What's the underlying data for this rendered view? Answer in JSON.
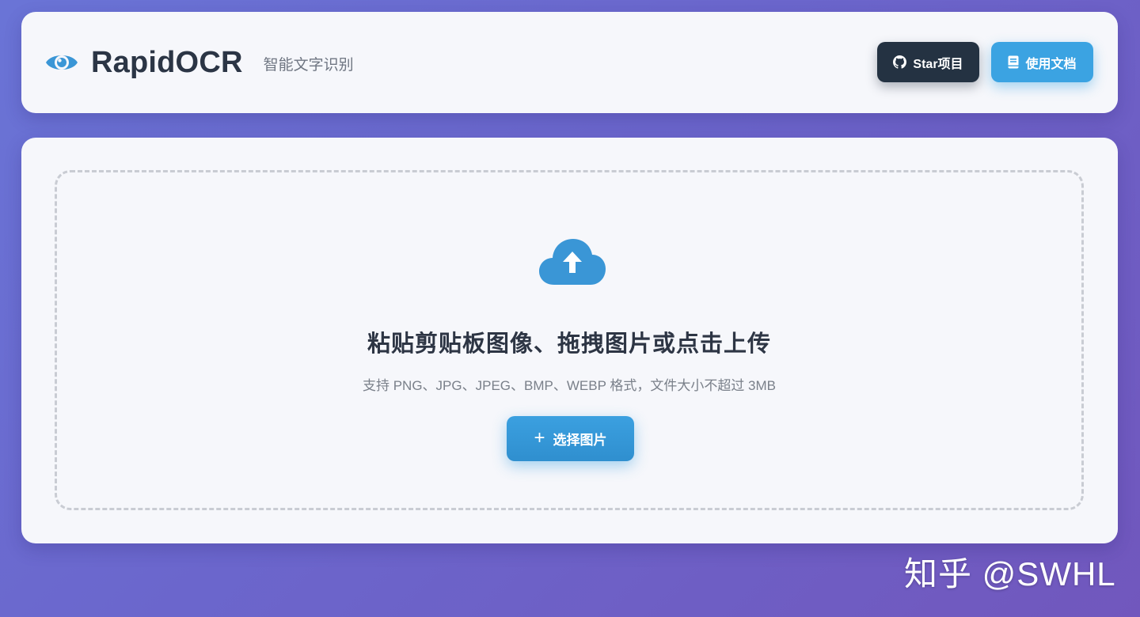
{
  "header": {
    "brand_name": "RapidOCR",
    "brand_subtitle": "智能文字识别",
    "logo_icon": "eye-icon",
    "star_button": {
      "label": "Star项目",
      "icon": "github-icon"
    },
    "docs_button": {
      "label": "使用文档",
      "icon": "book-icon"
    }
  },
  "upload": {
    "icon": "cloud-upload-icon",
    "title": "粘贴剪贴板图像、拖拽图片或点击上传",
    "hint": "支持 PNG、JPG、JPEG、BMP、WEBP 格式，文件大小不超过 3MB",
    "choose_button": {
      "plus": "+",
      "label": "选择图片"
    }
  },
  "watermark": "知乎 @SWHL",
  "colors": {
    "accent": "#3ba3e2",
    "dark_button": "#243242",
    "background_start": "#6a74d6",
    "background_end": "#7157bd"
  }
}
